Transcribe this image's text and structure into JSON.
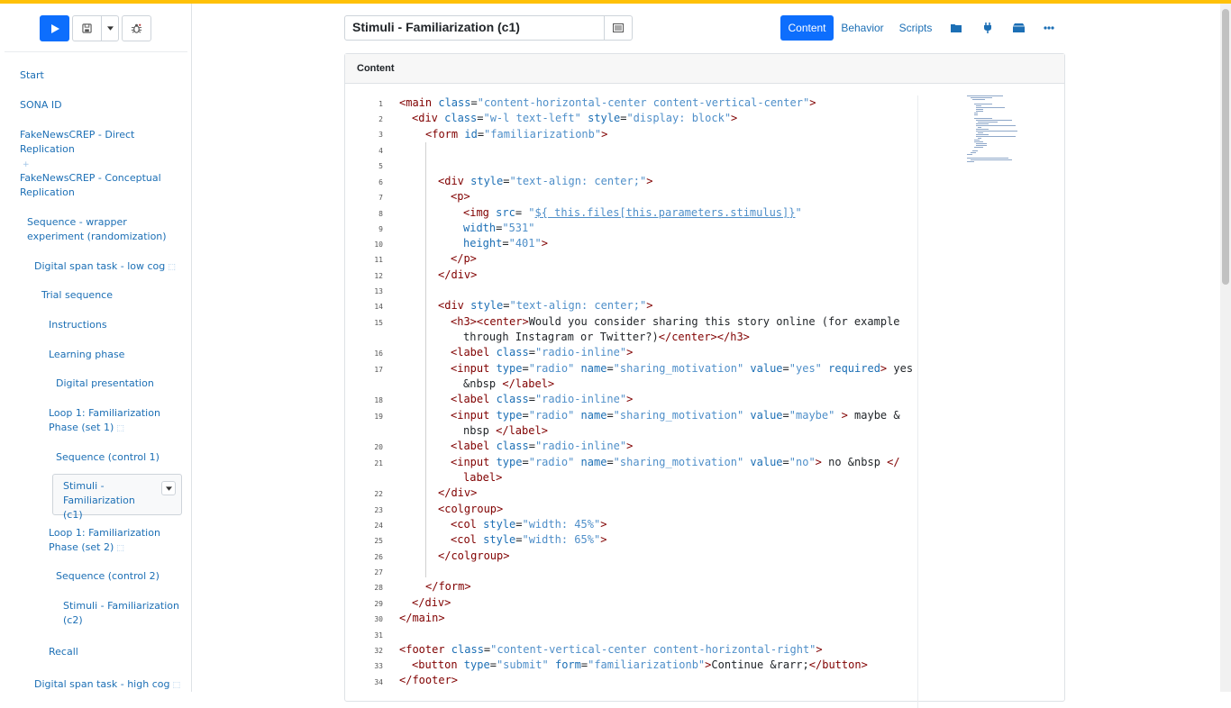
{
  "toolbar": {
    "run_icon": "play-icon",
    "save_icon": "save-icon",
    "dropdown_icon": "caret-down-icon",
    "debug_icon": "bug-icon"
  },
  "sidebar": {
    "items": [
      {
        "label": "Start"
      },
      {
        "label": "SONA ID"
      },
      {
        "label": "FakeNewsCREP - Direct Replication"
      },
      {
        "label": "FakeNewsCREP - Conceptual Replication"
      },
      {
        "label": "Sequence - wrapper experiment (randomization)"
      },
      {
        "label": "Digital span task - low cog"
      },
      {
        "label": "Trial sequence"
      },
      {
        "label": "Instructions"
      },
      {
        "label": "Learning phase"
      },
      {
        "label": "Digital presentation"
      },
      {
        "label": "Loop 1: Familiarization Phase (set 1)"
      },
      {
        "label": "Sequence (control 1)"
      },
      {
        "label": "Stimuli - Familiarization (c1)"
      },
      {
        "label": "Loop 1: Familiarization Phase (set 2)"
      },
      {
        "label": "Sequence (control 2)"
      },
      {
        "label": "Stimuli - Familiarization (c2)"
      },
      {
        "label": "Recall"
      },
      {
        "label": "Digital span task - high cog"
      }
    ]
  },
  "header": {
    "title_value": "Stimuli - Familiarization (c1)",
    "tabs": [
      {
        "label": "Content"
      },
      {
        "label": "Behavior"
      },
      {
        "label": "Scripts"
      }
    ],
    "icons": [
      "folder-icon",
      "plug-icon",
      "package-icon",
      "more-icon"
    ]
  },
  "editor": {
    "panel_title": "Content",
    "line_numbers": [
      "1",
      "2",
      "3",
      "4",
      "5",
      "6",
      "7",
      "8",
      "9",
      "10",
      "11",
      "12",
      "13",
      "14",
      "15",
      "",
      "16",
      "17",
      "",
      "18",
      "19",
      "",
      "20",
      "21",
      "",
      "22",
      "23",
      "24",
      "25",
      "26",
      "27",
      "28",
      "29",
      "30",
      "31",
      "32",
      "33",
      "34"
    ]
  }
}
